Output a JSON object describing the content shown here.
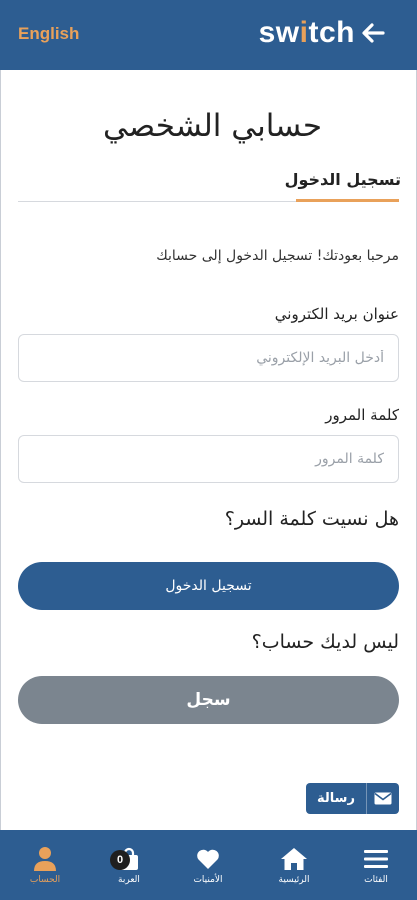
{
  "header": {
    "language_label": "English",
    "logo_text_start": "sw",
    "logo_text_dot": "i",
    "logo_text_end": "tch"
  },
  "page": {
    "title": "حسابي الشخصي",
    "tab_label": "تسجيل الدخول",
    "welcome": "مرحبا بعودتك! تسجيل الدخول إلى حسابك"
  },
  "form": {
    "email_label": "عنوان بريد الكتروني",
    "email_placeholder": "أدخل البريد الإلكتروني",
    "email_value": "",
    "password_label": "كلمة المرور",
    "password_placeholder": "كلمة المرور",
    "password_value": "",
    "forgot_password": "هل نسيت كلمة السر؟",
    "login_button": "تسجيل الدخول",
    "no_account": "ليس لديك حساب؟",
    "register_button": "سجل"
  },
  "message_button": {
    "label": "رسالة"
  },
  "bottom_nav": {
    "items": [
      {
        "label": "الفئات",
        "icon": "menu-icon"
      },
      {
        "label": "الرئيسية",
        "icon": "home-icon"
      },
      {
        "label": "الأمنيات",
        "icon": "heart-icon"
      },
      {
        "label": "العربة",
        "icon": "shopping-bag-icon",
        "badge": "0"
      },
      {
        "label": "الحساب",
        "icon": "user-icon",
        "active": true
      }
    ]
  },
  "colors": {
    "primary": "#2d5d91",
    "accent": "#e9a15a",
    "register_button": "#7b858f"
  }
}
